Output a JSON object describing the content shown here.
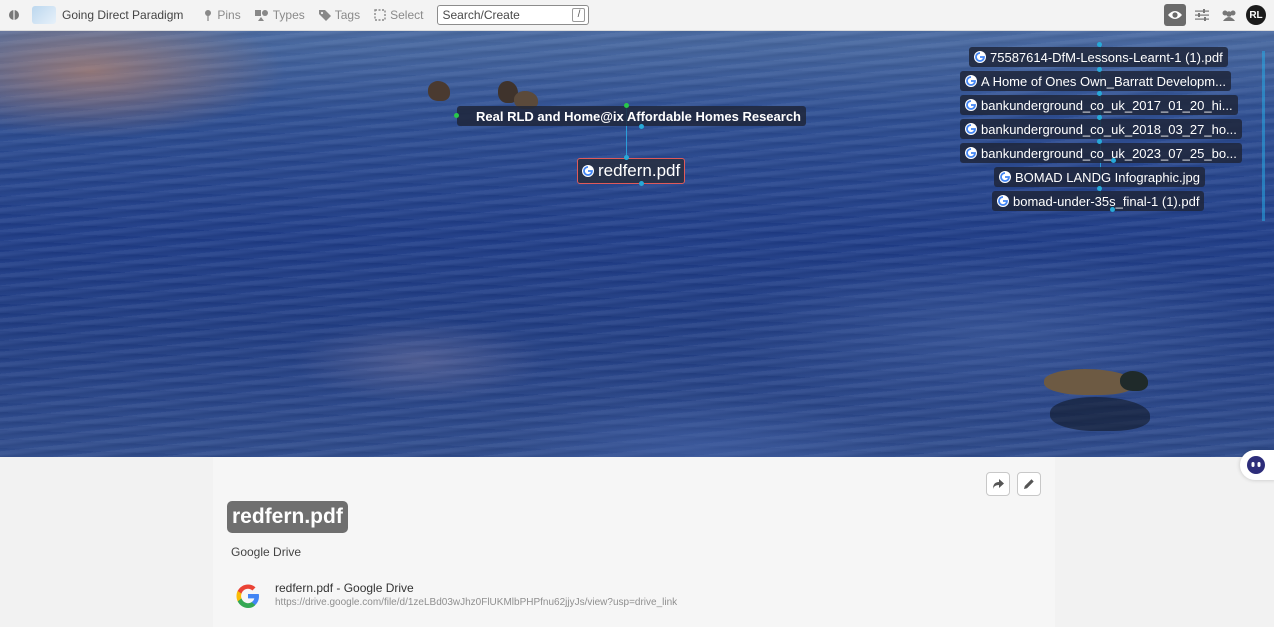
{
  "topbar": {
    "workspace_name": "Going Direct Paradigm",
    "pins_label": "Pins",
    "types_label": "Types",
    "tags_label": "Tags",
    "select_label": "Select",
    "search_placeholder": "Search/Create",
    "search_shortcut": "/",
    "avatar_initials": "RL"
  },
  "canvas": {
    "group_node": "Real RLD and Home@ix Affordable Homes Research",
    "selected_node": "redfern.pdf",
    "nodes": [
      "75587614-DfM-Lessons-Learnt-1 (1).pdf",
      "A Home of Ones Own_Barratt Developm...",
      "bankunderground_co_uk_2017_01_20_hi...",
      "bankunderground_co_uk_2018_03_27_ho...",
      "bankunderground_co_uk_2023_07_25_bo...",
      "BOMAD LANDG Infographic.jpg",
      "bomad-under-35s_final-1 (1).pdf"
    ]
  },
  "detail": {
    "title": "redfern.pdf",
    "source": "Google Drive",
    "link_title": "redfern.pdf - Google Drive",
    "link_url": "https://drive.google.com/file/d/1zeLBd03wJhz0FlUKMlbPHPfnu62jjyJs/view?usp=drive_link"
  },
  "colors": {
    "selected_border": "#e05a5a",
    "connector": "#27a9d8",
    "title_chip": "#6f6f6f"
  }
}
